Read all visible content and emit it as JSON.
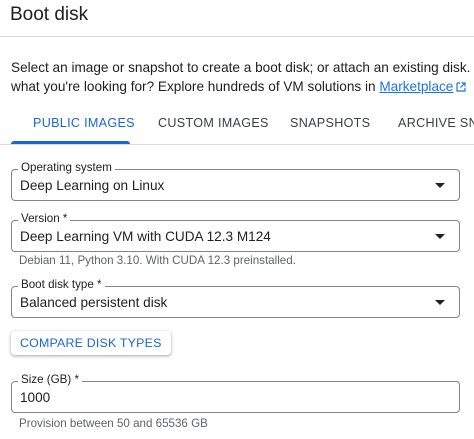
{
  "header": {
    "title": "Boot disk"
  },
  "intro": {
    "line1": "Select an image or snapshot to create a boot disk; or attach an existing disk. Can't find",
    "line2_prefix": "what you're looking for? Explore hundreds of VM solutions in ",
    "marketplace_link": "Marketplace"
  },
  "tabs": [
    {
      "label": "PUBLIC IMAGES",
      "active": true
    },
    {
      "label": "CUSTOM IMAGES",
      "active": false
    },
    {
      "label": "SNAPSHOTS",
      "active": false
    },
    {
      "label": "ARCHIVE SNAPSHOTS",
      "active": false
    }
  ],
  "form": {
    "operating_system": {
      "label": "Operating system",
      "value": "Deep Learning on Linux"
    },
    "version": {
      "label": "Version *",
      "value": "Deep Learning VM with CUDA 12.3 M124",
      "hint": "Debian 11, Python 3.10. With CUDA 12.3 preinstalled."
    },
    "boot_disk_type": {
      "label": "Boot disk type *",
      "value": "Balanced persistent disk"
    },
    "compare_button": "COMPARE DISK TYPES",
    "size": {
      "label": "Size (GB) *",
      "value": "1000",
      "hint": "Provision between 50 and 65536 GB"
    }
  },
  "colors": {
    "accent": "#1967d2",
    "link": "#1a73e8",
    "border": "#80868b",
    "divider": "#dadce0",
    "hint_text": "#5f6368"
  },
  "icons": {
    "external_link": "open-in-new-icon",
    "dropdown": "arrow-drop-down-icon"
  }
}
